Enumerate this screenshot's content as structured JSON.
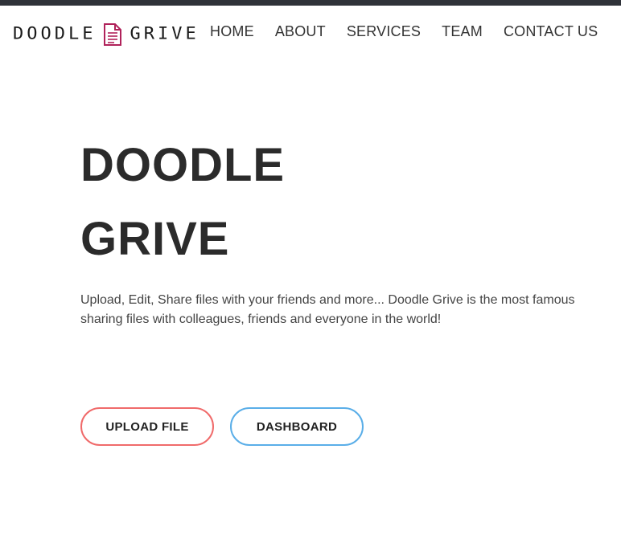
{
  "logo": {
    "left_word": "DOODLE",
    "right_word": "GRIVE",
    "icon": "document-icon",
    "icon_color": "#b0225a"
  },
  "nav": {
    "items": [
      "HOME",
      "ABOUT",
      "SERVICES",
      "TEAM",
      "CONTACT US"
    ]
  },
  "hero": {
    "title_line1": "DOODLE",
    "title_line2": "GRIVE",
    "description_line1": "Upload, Edit, Share files with your friends and more... Doodle Grive is the most famous",
    "description_line2": "sharing files with colleagues, friends and everyone in the world!"
  },
  "buttons": {
    "upload": "UPLOAD FILE",
    "dashboard": "DASHBOARD",
    "upload_border_color": "#f06a6a",
    "dashboard_border_color": "#5aaee8"
  }
}
